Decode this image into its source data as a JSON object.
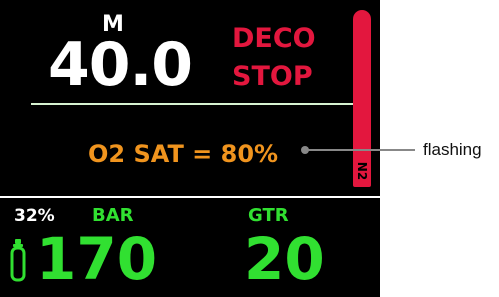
{
  "display": {
    "depth_unit": "M",
    "depth_value": "40.0",
    "deco_line_1": "DECO",
    "deco_line_2": "STOP",
    "n2_label": "N2",
    "o2_saturation": "O2 SAT = 80%",
    "o2_percent": "32%",
    "bar_label": "BAR",
    "bar_value": "170",
    "gtr_label": "GTR",
    "gtr_value": "20"
  },
  "callout": {
    "label": "flashing"
  },
  "colors": {
    "background": "#000000",
    "primary_text": "#ffffff",
    "warning": "#e3173e",
    "o2_text": "#f0941e",
    "gas_text": "#31e031",
    "callout_line": "#888888"
  },
  "icons": {
    "n2_bar": "tissue-loading-bar",
    "cylinder": "gas-cylinder-icon"
  }
}
